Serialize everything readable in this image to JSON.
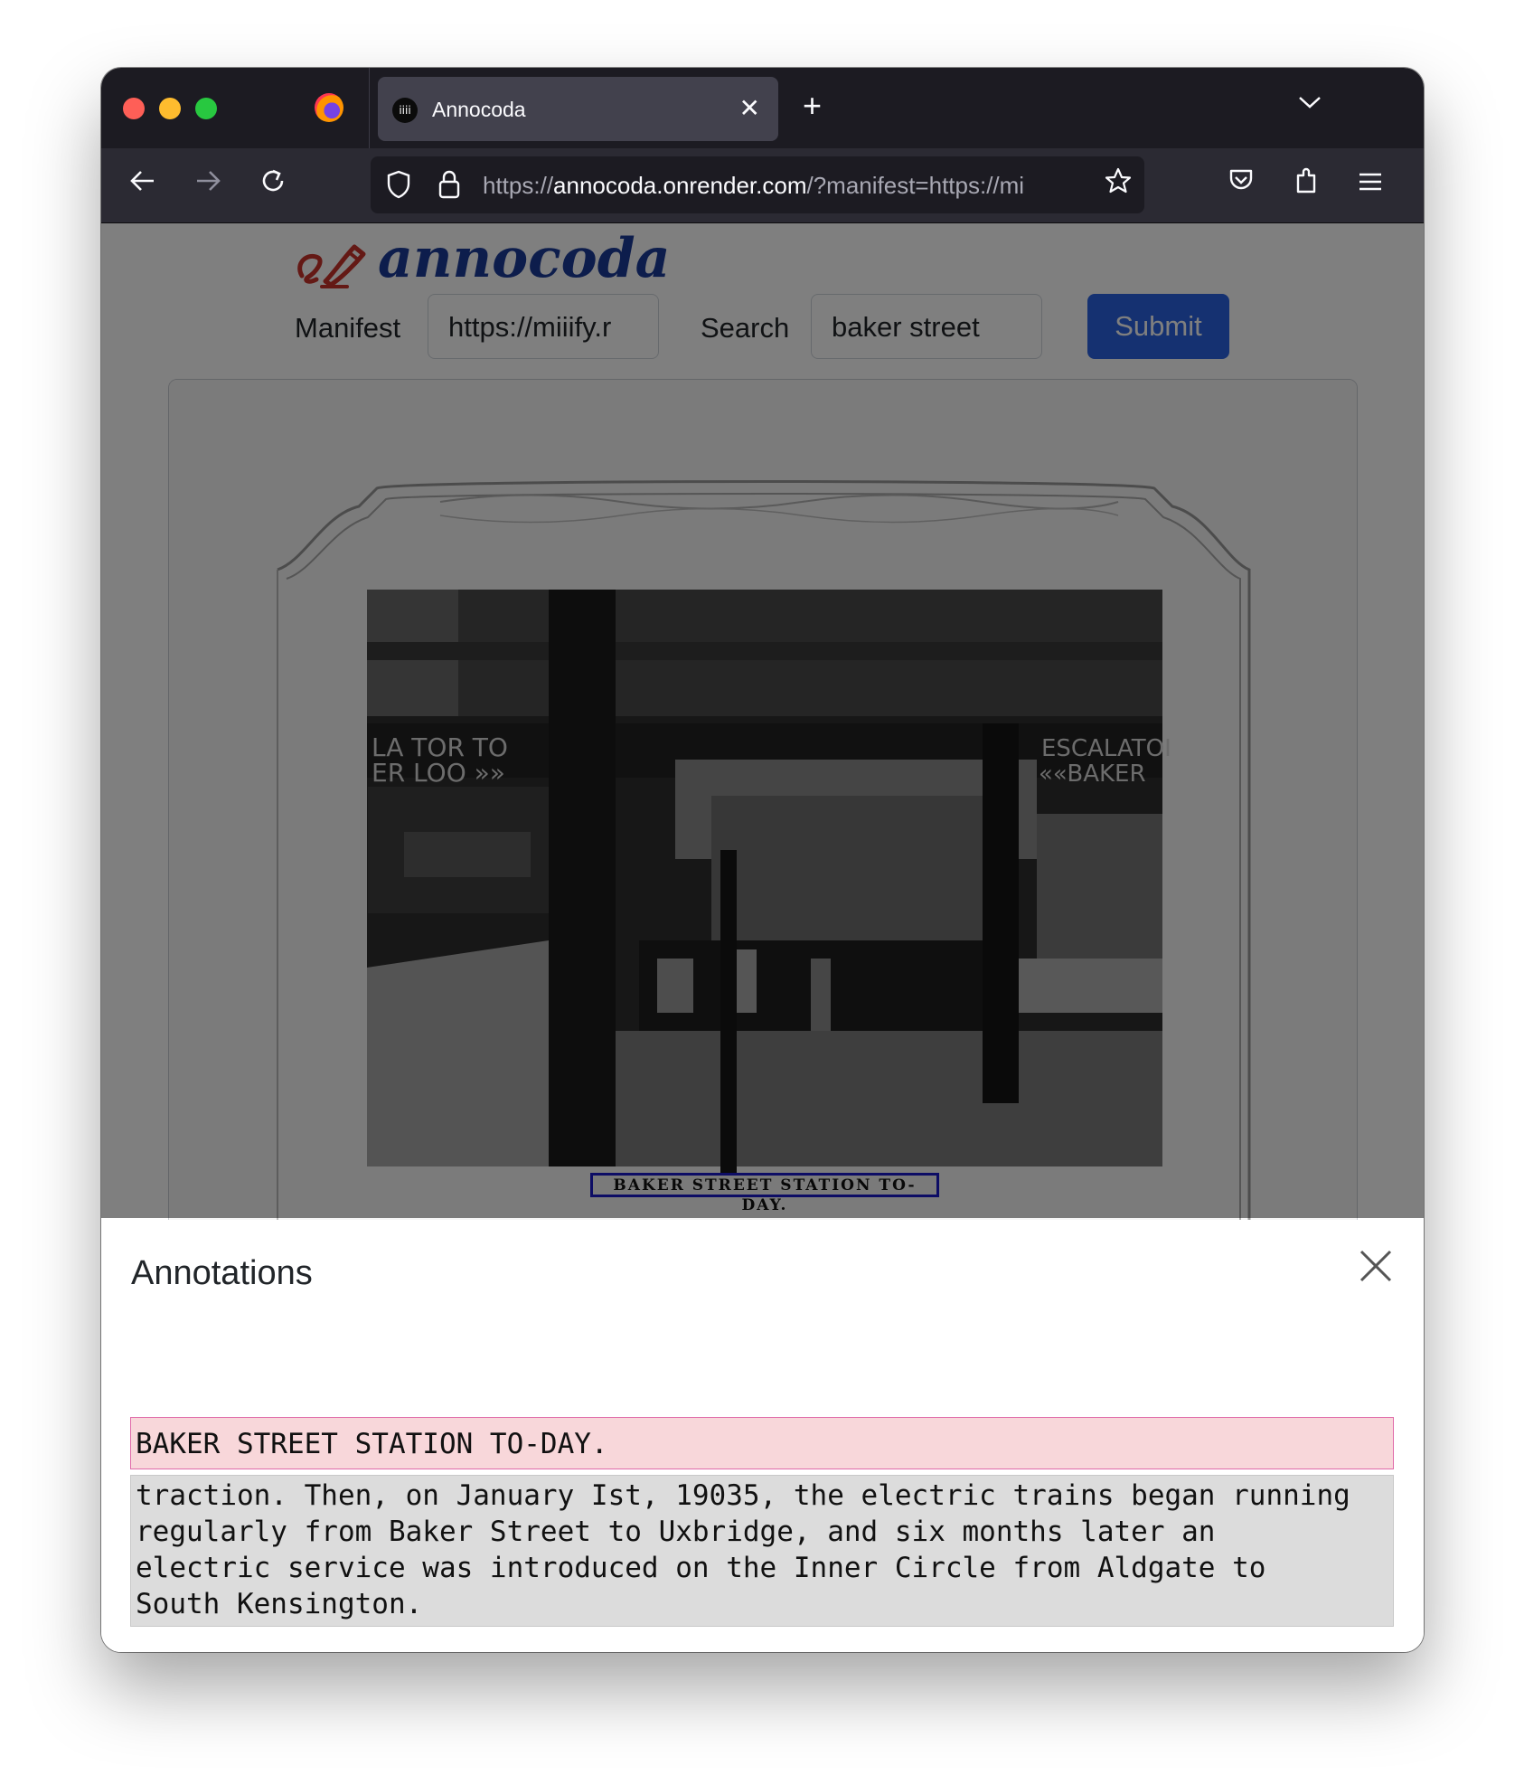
{
  "window": {
    "tab_title": "Annocoda",
    "tab_icon_glyph": "iiii",
    "url_prefix": "https://",
    "url_host": "annocoda.onrender.com",
    "url_path": "/?manifest=https://mi"
  },
  "page": {
    "brand": "annocoda",
    "manifest_label": "Manifest",
    "manifest_value": "https://miiify.r",
    "search_label": "Search",
    "search_value": "baker street",
    "submit_label": "Submit"
  },
  "viewer": {
    "caption_text": "BAKER STREET STATION TO-DAY."
  },
  "annotations": {
    "title": "Annotations",
    "items": [
      {
        "text": "BAKER STREET STATION TO-DAY.",
        "active": true
      }
    ],
    "body": "traction. Then, on January Ist, 19035, the electric trains began running\nregularly from Baker Street to Uxbridge, and six months later an\nelectric service was introduced on the Inner Circle from Aldgate to\nSouth Kensington."
  },
  "colors": {
    "brand_blue": "#1a3a99",
    "brand_red": "#c8322b",
    "submit_blue": "#2b63e2",
    "highlight_pink": "#f8d7da",
    "highlight_border": "#e06aa9",
    "caption_box": "#1a1acb"
  },
  "icons": [
    "back-arrow-icon",
    "forward-arrow-icon",
    "reload-icon",
    "shield-icon",
    "lock-icon",
    "star-icon",
    "pocket-icon",
    "extensions-icon",
    "hamburger-menu-icon",
    "close-icon",
    "plus-icon",
    "chevron-down-icon"
  ]
}
